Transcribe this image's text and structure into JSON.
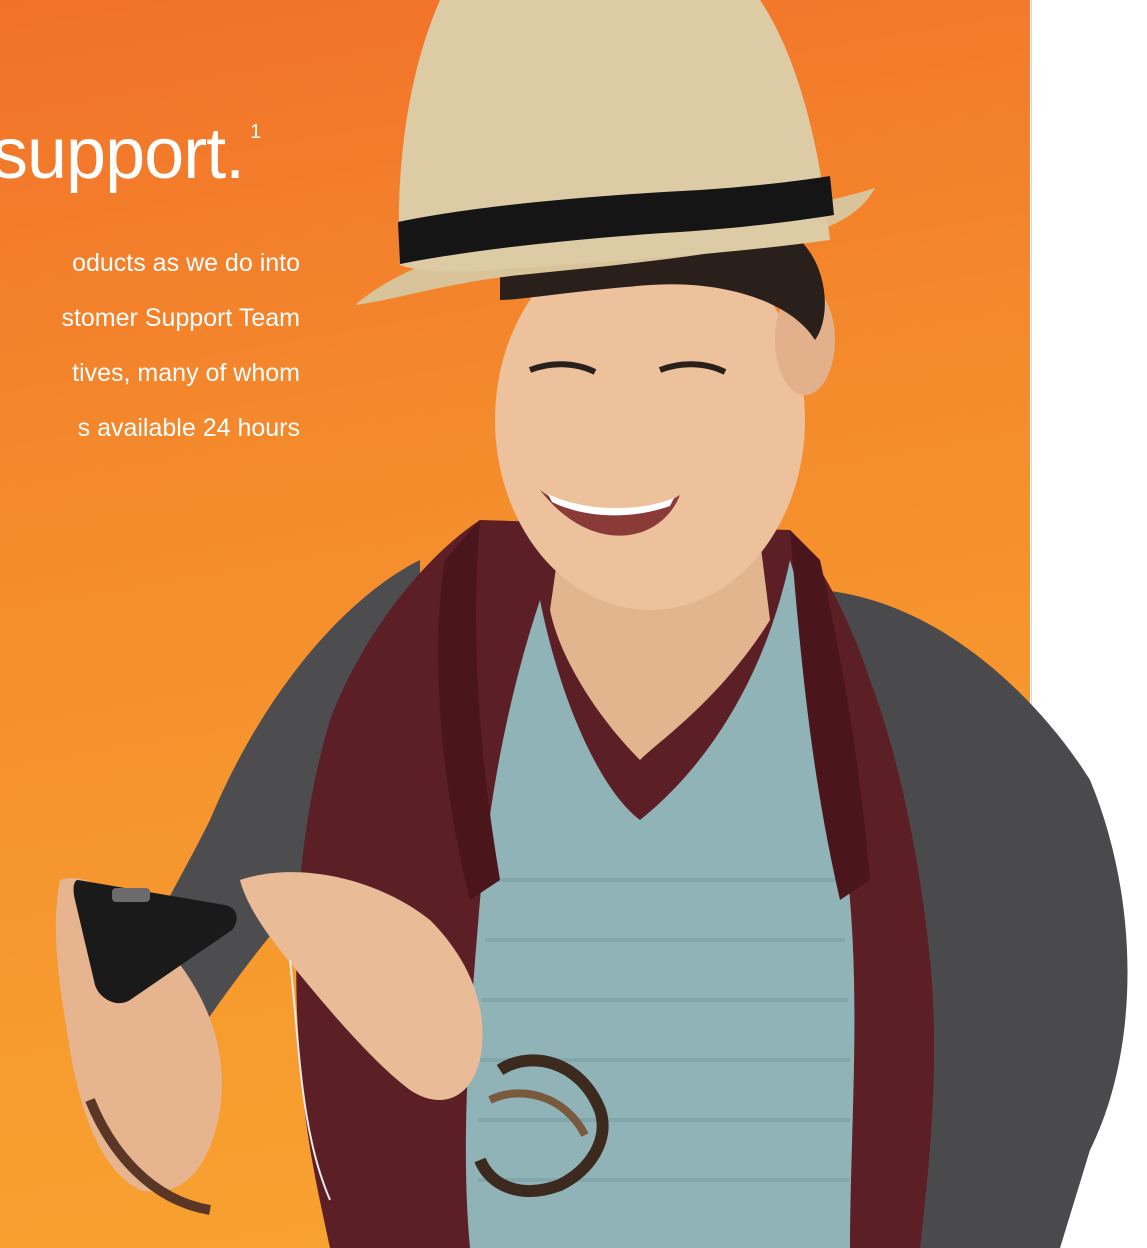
{
  "heading": {
    "text": "support.",
    "footnote_marker": "1"
  },
  "body_lines": [
    "oducts as we do into",
    "stomer Support Team",
    "tives, many of whom",
    "s available 24 hours"
  ],
  "colors": {
    "accent_orange_top": "#f2712a",
    "accent_orange_bottom": "#f7a431",
    "text": "#ffffff"
  },
  "illustration": {
    "subject": "smiling man in straw fedora using a phone",
    "icons": [
      "straw-hat-icon",
      "phone-icon",
      "bracelet-icon"
    ]
  }
}
